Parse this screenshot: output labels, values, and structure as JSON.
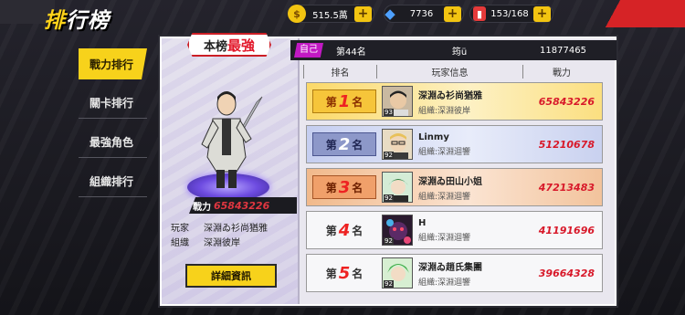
{
  "title": {
    "part1": "排",
    "part2": "行榜"
  },
  "currency": [
    {
      "icon": "gold-coin-icon",
      "value": "515.5萬",
      "color": "#f2c411",
      "glyph": "$"
    },
    {
      "icon": "blue-diamond-icon",
      "value": "7736",
      "color": "#4ea0ff",
      "glyph": "◆"
    },
    {
      "icon": "red-ticket-icon",
      "value": "153/168",
      "color": "#e53a3a",
      "glyph": "▮"
    }
  ],
  "nav": [
    {
      "label": "戰力排行",
      "active": true
    },
    {
      "label": "關卡排行",
      "active": false
    },
    {
      "label": "最強角色",
      "active": false
    },
    {
      "label": "組織排行",
      "active": false
    }
  ],
  "badge": {
    "part1": "本榜",
    "part2": "最強"
  },
  "hero": {
    "power_label": "戰力",
    "power_value": "65843226",
    "player_label": "玩家",
    "player_value": "深淵ゐ衫尚猶雅",
    "org_label": "組織",
    "org_value": "深淵彼岸",
    "detail_button": "詳細資訊"
  },
  "self": {
    "tag": "自己",
    "rank": "第44名",
    "name": "筠ü",
    "power": "11877465"
  },
  "table": {
    "headers": [
      "排名",
      "玩家信息",
      "戰力"
    ],
    "prefix": "第",
    "suffix": "名",
    "rows": [
      {
        "rank": "1",
        "level": "93",
        "name": "深淵ゐ衫尚猶雅",
        "org": "組織:深淵彼岸",
        "power": "65843226"
      },
      {
        "rank": "2",
        "level": "92",
        "name": "Linmy",
        "org": "組織:深淵迴響",
        "power": "51210678"
      },
      {
        "rank": "3",
        "level": "92",
        "name": "深淵ゐ田山小姐",
        "org": "組織:深淵迴響",
        "power": "47213483"
      },
      {
        "rank": "4",
        "level": "92",
        "name": "H",
        "org": "組織:深淵迴響",
        "power": "41191696"
      },
      {
        "rank": "5",
        "level": "92",
        "name": "深淵ゐ趙氏集團",
        "org": "組織:深淵迴響",
        "power": "39664328"
      }
    ]
  }
}
